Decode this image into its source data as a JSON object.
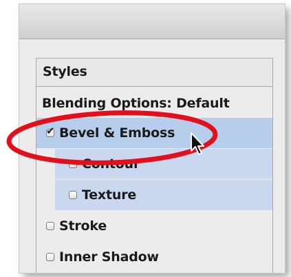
{
  "styles_panel": {
    "header": "Styles",
    "items": [
      {
        "label": "Blending Options: Default",
        "checkbox": false
      },
      {
        "label": "Bevel & Emboss",
        "checkbox": true,
        "checked": true,
        "selected": true
      },
      {
        "label": "Contour",
        "checkbox": true,
        "checked": false,
        "sub": true
      },
      {
        "label": "Texture",
        "checkbox": true,
        "checked": false,
        "sub": true
      },
      {
        "label": "Stroke",
        "checkbox": true,
        "checked": false
      },
      {
        "label": "Inner Shadow",
        "checkbox": true,
        "checked": false
      }
    ]
  },
  "icons": {
    "cursor": "arrow-cursor-icon",
    "checkmark": "✔"
  },
  "colors": {
    "selected_row": "#b7cdec",
    "sub_row": "#c9d8ef",
    "annotation_ellipse": "#e3101c"
  }
}
